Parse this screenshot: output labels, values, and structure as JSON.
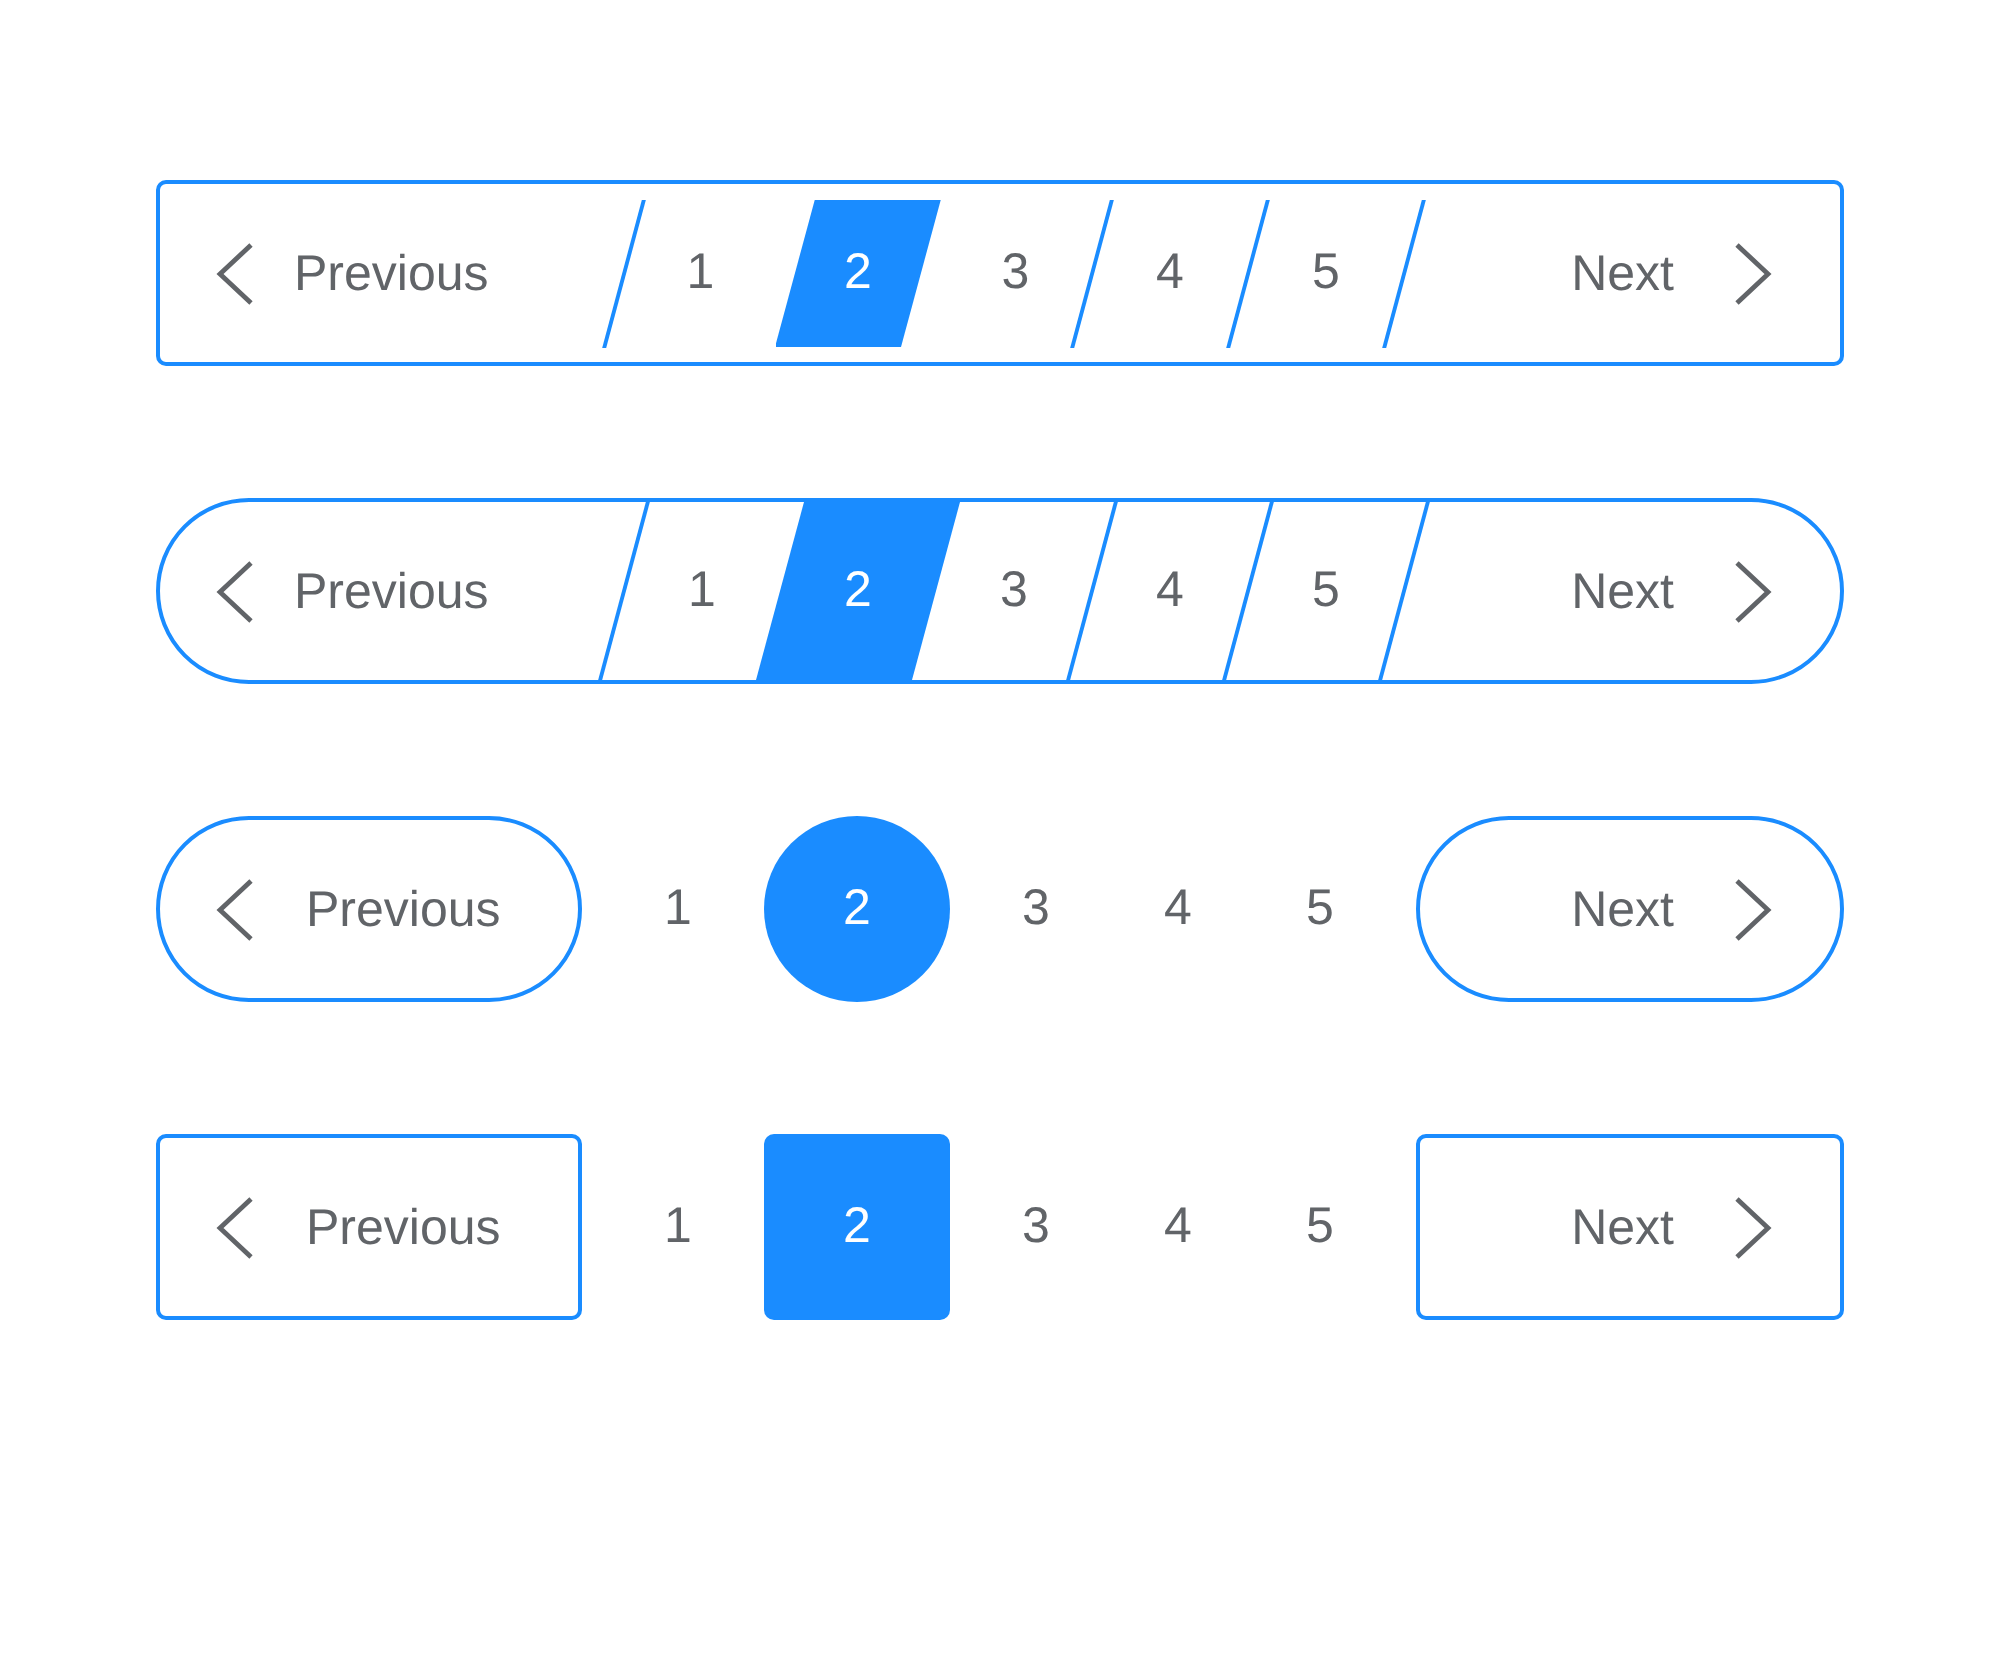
{
  "paginations": [
    {
      "kind": "slanted-box",
      "previous": "Previous",
      "pages": [
        {
          "label": "1",
          "selected": false
        },
        {
          "label": "2",
          "selected": true
        },
        {
          "label": "3",
          "selected": false
        },
        {
          "label": "4",
          "selected": false
        },
        {
          "label": "5",
          "selected": false
        }
      ],
      "next": "Next"
    },
    {
      "kind": "slanted-pill",
      "previous": "Previous",
      "pages": [
        {
          "label": "1",
          "selected": false
        },
        {
          "label": "2",
          "selected": true
        },
        {
          "label": "3",
          "selected": false
        },
        {
          "label": "4",
          "selected": false
        },
        {
          "label": "5",
          "selected": false
        }
      ],
      "next": "Next"
    },
    {
      "kind": "circle",
      "previous": "Previous",
      "pages": [
        {
          "label": "1",
          "selected": false
        },
        {
          "label": "2",
          "selected": true
        },
        {
          "label": "3",
          "selected": false
        },
        {
          "label": "4",
          "selected": false
        },
        {
          "label": "5",
          "selected": false
        }
      ],
      "next": "Next"
    },
    {
      "kind": "square",
      "previous": "Previous",
      "pages": [
        {
          "label": "1",
          "selected": false
        },
        {
          "label": "2",
          "selected": true
        },
        {
          "label": "3",
          "selected": false
        },
        {
          "label": "4",
          "selected": false
        },
        {
          "label": "5",
          "selected": false
        }
      ],
      "next": "Next"
    }
  ]
}
